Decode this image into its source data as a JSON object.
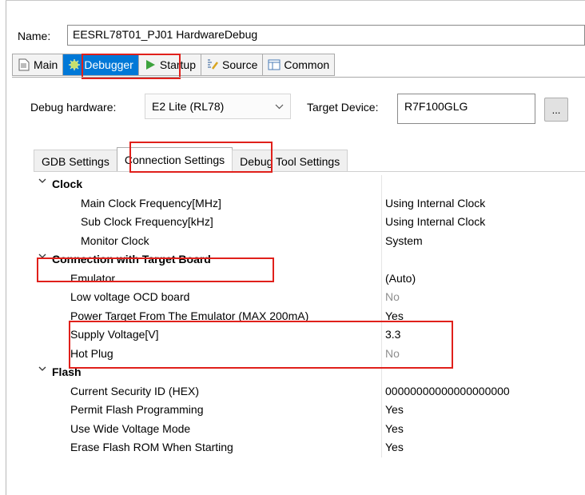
{
  "name_field": {
    "label": "Name:",
    "value": "EESRL78T01_PJ01 HardwareDebug"
  },
  "tabs": [
    {
      "label": "Main",
      "icon": "main-page-icon"
    },
    {
      "label": "Debugger",
      "icon": "debugger-bug-icon"
    },
    {
      "label": "Startup",
      "icon": "startup-play-icon"
    },
    {
      "label": "Source",
      "icon": "source-icon"
    },
    {
      "label": "Common",
      "icon": "common-table-icon"
    }
  ],
  "debug_hardware": {
    "label": "Debug hardware:",
    "value": "E2 Lite (RL78)"
  },
  "target_device": {
    "label": "Target Device:",
    "value": "R7F100GLG",
    "browse_label": "..."
  },
  "sub_tabs": [
    "GDB Settings",
    "Connection Settings",
    "Debug Tool Settings"
  ],
  "settings": {
    "clock": {
      "title": "Clock",
      "rows": [
        {
          "label": "Main Clock Frequency[MHz]",
          "value": "Using Internal Clock"
        },
        {
          "label": "Sub Clock Frequency[kHz]",
          "value": "Using Internal Clock"
        },
        {
          "label": "Monitor Clock",
          "value": "System"
        }
      ]
    },
    "connection": {
      "title": "Connection with Target Board",
      "rows": [
        {
          "label": "Emulator",
          "value": "(Auto)"
        },
        {
          "label": "Low voltage OCD board",
          "value": "No"
        },
        {
          "label": "Power Target From The Emulator (MAX 200mA)",
          "value": "Yes"
        },
        {
          "label": "Supply Voltage[V]",
          "value": "3.3"
        },
        {
          "label": "Hot Plug",
          "value": "No"
        }
      ]
    },
    "flash": {
      "title": "Flash",
      "rows": [
        {
          "label": "Current Security ID (HEX)",
          "value": "00000000000000000000"
        },
        {
          "label": "Permit Flash Programming",
          "value": "Yes"
        },
        {
          "label": "Use Wide Voltage Mode",
          "value": "Yes"
        },
        {
          "label": "Erase Flash ROM When Starting",
          "value": "Yes"
        }
      ]
    }
  },
  "colors": {
    "highlight": "#e0201b",
    "active_tab": "#0078d7",
    "dim_value": "#8e8e8e"
  }
}
